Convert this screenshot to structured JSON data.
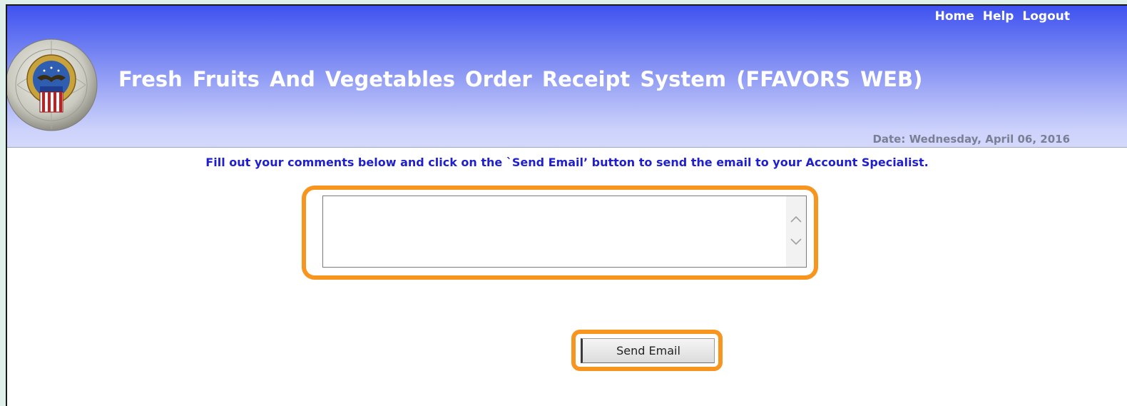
{
  "header": {
    "nav_links": [
      "Home",
      "Help",
      "Logout"
    ],
    "app_title": "Fresh  Fruits  And  Vegetables  Order  Receipt  System (FFAVORS WEB)",
    "date_text": "Date: Wednesday, April 06, 2016",
    "seal_icon": "dla-seal-icon"
  },
  "main": {
    "instructions": "Fill out your comments below and click on the `Send Email’ button to send the email to your Account Specialist.",
    "comments_value": "",
    "send_button_label": "Send Email"
  },
  "colors": {
    "header_top": "#3f52f0",
    "header_bottom": "#d3d8fb",
    "instruction_text": "#1f1fd0",
    "highlight": "#f7951e"
  }
}
